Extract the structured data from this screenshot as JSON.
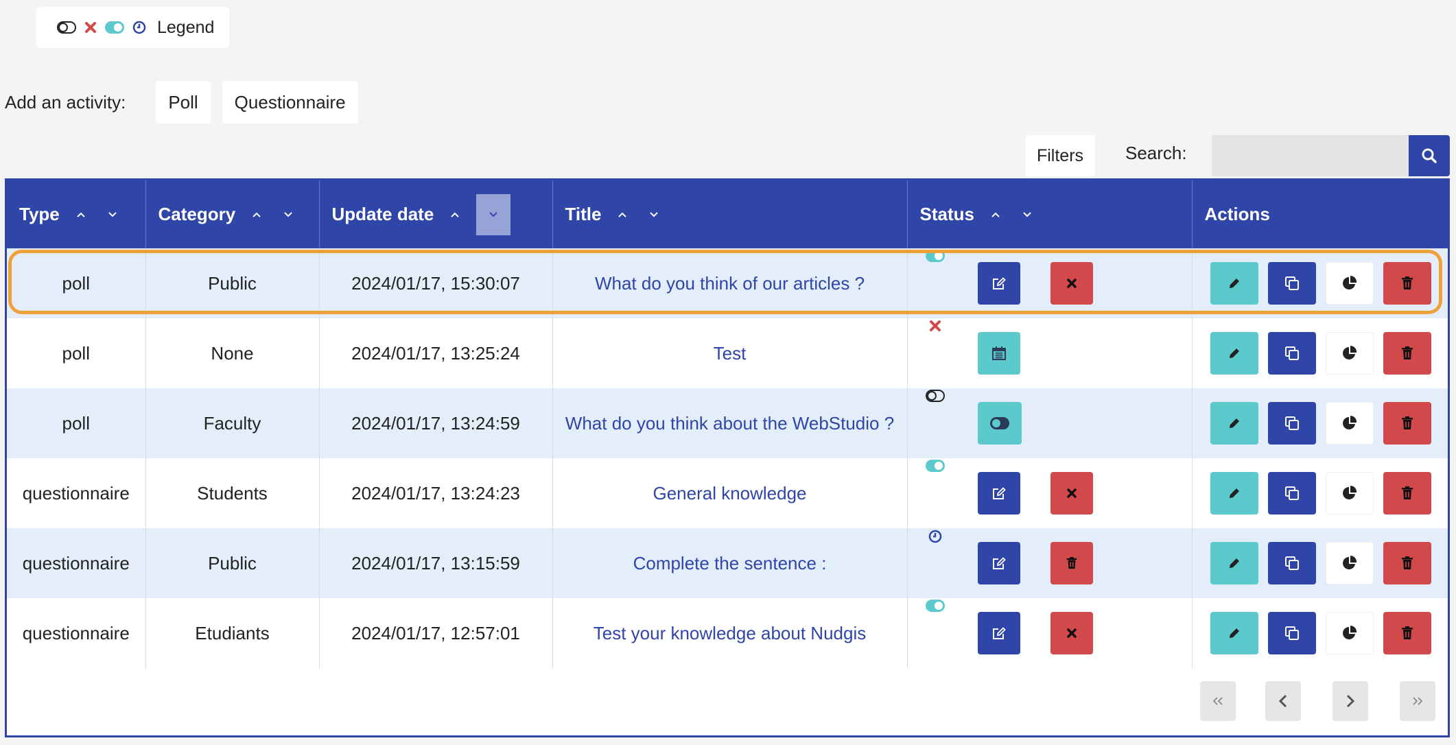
{
  "legend": {
    "label": "Legend"
  },
  "add_activity": {
    "label": "Add an activity:",
    "buttons": [
      "Poll",
      "Questionnaire"
    ]
  },
  "toolbar": {
    "filters_label": "Filters",
    "search_label": "Search:",
    "search_value": ""
  },
  "table": {
    "columns": [
      "Type",
      "Category",
      "Update date",
      "Title",
      "Status",
      "Actions"
    ],
    "rows": [
      {
        "type": "poll",
        "category": "Public",
        "date": "2024/01/17, 15:30:07",
        "title": "What do you think of our articles ?",
        "status": "online",
        "highlighted": true
      },
      {
        "type": "poll",
        "category": "None",
        "date": "2024/01/17, 13:25:24",
        "title": "Test",
        "status": "error",
        "highlighted": false
      },
      {
        "type": "poll",
        "category": "Faculty",
        "date": "2024/01/17, 13:24:59",
        "title": "What do you think about the WebStudio ?",
        "status": "offline",
        "highlighted": false
      },
      {
        "type": "questionnaire",
        "category": "Students",
        "date": "2024/01/17, 13:24:23",
        "title": "General knowledge",
        "status": "online",
        "highlighted": false
      },
      {
        "type": "questionnaire",
        "category": "Public",
        "date": "2024/01/17, 13:15:59",
        "title": "Complete the sentence :",
        "status": "scheduled",
        "highlighted": false
      },
      {
        "type": "questionnaire",
        "category": "Etudiants",
        "date": "2024/01/17, 12:57:01",
        "title": "Test your knowledge about Nudgis",
        "status": "online",
        "highlighted": false
      }
    ]
  },
  "colors": {
    "primary": "#2f45a8",
    "danger": "#d1494b",
    "teal": "#5ccacc",
    "highlight": "#f0a038",
    "row_alt": "#e3eefa"
  },
  "icons": {
    "legend": [
      "toggle-off-icon",
      "close-icon",
      "toggle-on-icon",
      "clock-icon"
    ],
    "actions": [
      "pencil-icon",
      "copy-icon",
      "pie-chart-icon",
      "trash-icon"
    ],
    "pager": [
      "first-page-icon",
      "prev-page-icon",
      "next-page-icon",
      "last-page-icon"
    ]
  }
}
